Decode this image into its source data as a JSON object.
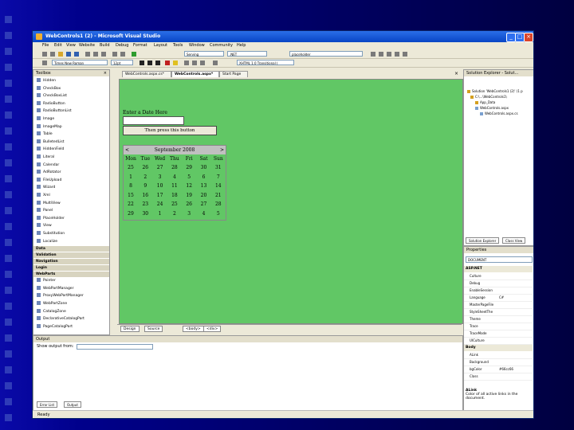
{
  "app": {
    "title": "WebControls1 (2) - Microsoft Visual Studio",
    "window_buttons": [
      "_",
      "□",
      "×"
    ]
  },
  "menu": [
    "File",
    "Edit",
    "View",
    "Website",
    "Build",
    "Debug",
    "Format",
    "Layout",
    "Tools",
    "Window",
    "Community",
    "Help"
  ],
  "toolbars": {
    "target_combo": "Serving",
    "config_combo": ".NET",
    "find_combo": "placeholder",
    "font_combo": "Times New Roman",
    "size_combo": "12pt",
    "schema_combo": "XHTML 1.0 Transitional ("
  },
  "toolbox": {
    "title": "Toolbox",
    "standard_items": [
      "Hidden",
      "CheckBox",
      "CheckBoxList",
      "RadioButton",
      "RadioButtonList",
      "Image",
      "ImageMap",
      "Table",
      "BulletedList",
      "HiddenField",
      "Literal",
      "Calendar",
      "AdRotator",
      "FileUpload",
      "Wizard",
      "Xml",
      "MultiView",
      "Panel",
      "PlaceHolder",
      "View",
      "Substitution",
      "Localize"
    ],
    "groups": [
      "Data",
      "Validation",
      "Navigation",
      "Login",
      "WebParts"
    ],
    "webparts_items": [
      "Pointer",
      "WebPartManager",
      "ProxyWebPartManager",
      "WebPartZone",
      "CatalogZone",
      "DeclarativeCatalogPart",
      "PageCatalogPart"
    ]
  },
  "doc_tabs": [
    "WebControls.aspx.cs*",
    "WebControls.aspx*",
    "Start Page"
  ],
  "designer": {
    "prompt": "Enter a Date Here",
    "button_label": "Then press this button",
    "calendar": {
      "prev": "<",
      "next": ">",
      "month_title": "September 2008",
      "days": [
        "Mon",
        "Tue",
        "Wed",
        "Thu",
        "Fri",
        "Sat",
        "Sun"
      ],
      "weeks": [
        [
          "25",
          "26",
          "27",
          "28",
          "29",
          "30",
          "31"
        ],
        [
          "1",
          "2",
          "3",
          "4",
          "5",
          "6",
          "7"
        ],
        [
          "8",
          "9",
          "10",
          "11",
          "12",
          "13",
          "14"
        ],
        [
          "15",
          "16",
          "17",
          "18",
          "19",
          "20",
          "21"
        ],
        [
          "22",
          "23",
          "24",
          "25",
          "26",
          "27",
          "28"
        ],
        [
          "29",
          "30",
          "1",
          "2",
          "3",
          "4",
          "5"
        ]
      ]
    }
  },
  "view_bar": {
    "design": "Design",
    "source": "Source",
    "tag1": "<body>",
    "tag2": "<div>"
  },
  "solution_explorer": {
    "title": "Solution Explorer - Solut...",
    "items": [
      "Solution 'WebControls1 (2)' (1 p",
      "C:\\...\\WebControls1\\",
      "App_Data",
      "WebControls.aspx",
      "WebControls.aspx.cs"
    ],
    "bottom_tabs": [
      "Solution Explorer",
      "Class View"
    ]
  },
  "properties": {
    "title": "Properties",
    "object": "DOCUMENT",
    "categories": [
      "ASP.NET",
      "Body"
    ],
    "rows_aspnet": [
      {
        "name": "Culture",
        "value": ""
      },
      {
        "name": "Debug",
        "value": ""
      },
      {
        "name": "EnableSession",
        "value": ""
      },
      {
        "name": "Language",
        "value": "C#"
      },
      {
        "name": "MasterPageFile",
        "value": ""
      },
      {
        "name": "StyleSheetThe",
        "value": ""
      },
      {
        "name": "Theme",
        "value": ""
      },
      {
        "name": "Trace",
        "value": ""
      },
      {
        "name": "TraceMode",
        "value": ""
      },
      {
        "name": "UICulture",
        "value": ""
      }
    ],
    "rows_body": [
      {
        "name": "ALink",
        "value": ""
      },
      {
        "name": "Background",
        "value": ""
      },
      {
        "name": "bgColor",
        "value": "#66cc66"
      },
      {
        "name": "Class",
        "value": ""
      }
    ],
    "desc_title": "ALink",
    "desc_text": "Color of all active links in the document."
  },
  "output": {
    "title": "Output",
    "show_from": "Show output from:",
    "bottom_tabs": [
      "Error List",
      "Output"
    ]
  },
  "status": "Ready",
  "colors": {
    "design_surface": "#61c765",
    "title_bar": "#0845c5",
    "slide_bg": "#00008b"
  }
}
